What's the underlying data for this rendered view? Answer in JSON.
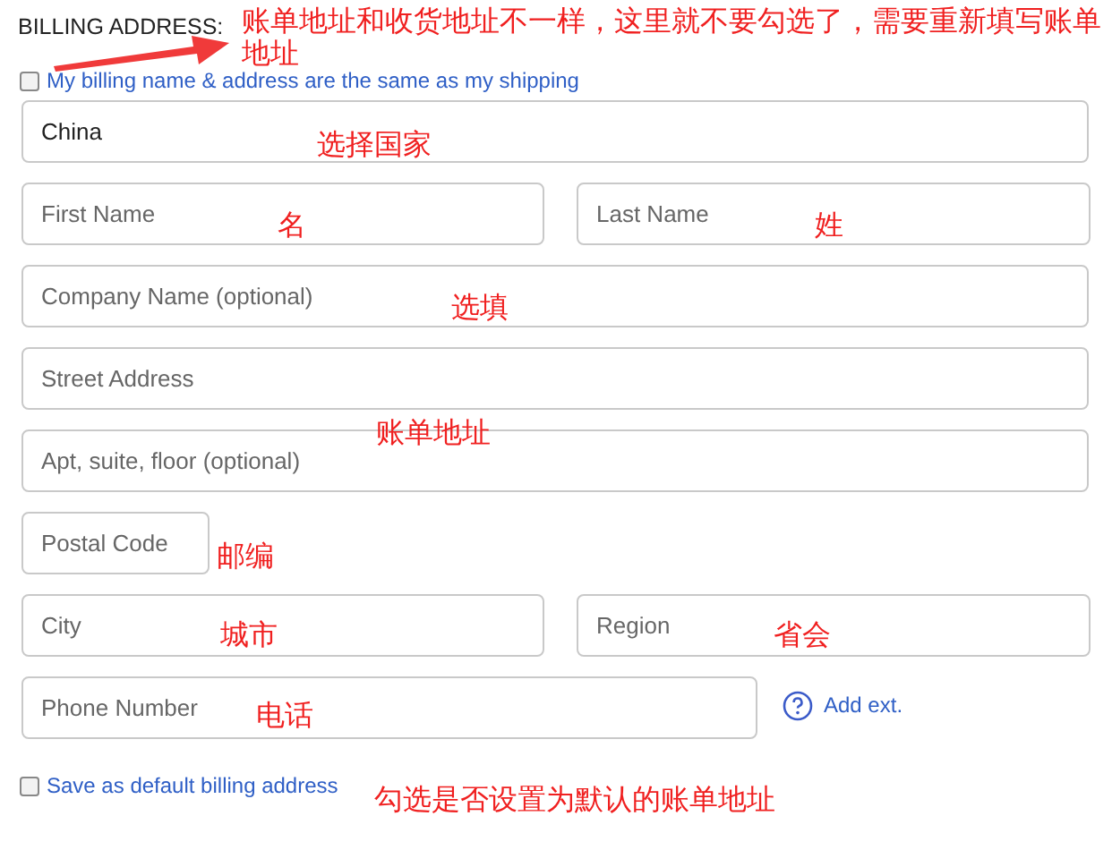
{
  "heading": "BILLING ADDRESS:",
  "same_as_shipping": {
    "label": "My billing name & address are the same as my shipping",
    "checked": false
  },
  "rows": [
    {
      "fields": [
        {
          "value": "China"
        }
      ]
    },
    {
      "fields": [
        {
          "placeholder": "First Name"
        },
        {
          "placeholder": "Last Name"
        }
      ]
    },
    {
      "fields": [
        {
          "placeholder": "Company Name (optional)"
        }
      ]
    },
    {
      "fields": [
        {
          "placeholder": "Street Address"
        }
      ]
    },
    {
      "fields": [
        {
          "placeholder": "Apt, suite, floor (optional)"
        }
      ]
    },
    {
      "fields": [
        {
          "placeholder": "Postal Code"
        }
      ]
    },
    {
      "fields": [
        {
          "placeholder": "City"
        },
        {
          "placeholder": "Region"
        }
      ]
    },
    {
      "fields": [
        {
          "placeholder": "Phone Number"
        }
      ],
      "help": true,
      "link": "Add ext."
    }
  ],
  "save_default": {
    "label": "Save as default billing address",
    "checked": false
  },
  "annotations": [
    {
      "text": "账单地址和收货地址不一样，这里就不要勾选了，需要重新填写账单地址"
    },
    {
      "text": "选择国家"
    },
    {
      "text": "名"
    },
    {
      "text": "姓"
    },
    {
      "text": "选填"
    },
    {
      "text": "账单地址"
    },
    {
      "text": "邮编"
    },
    {
      "text": "城市"
    },
    {
      "text": "省会"
    },
    {
      "text": "电话"
    },
    {
      "text": "勾选是否设置为默认的账单地址"
    }
  ]
}
